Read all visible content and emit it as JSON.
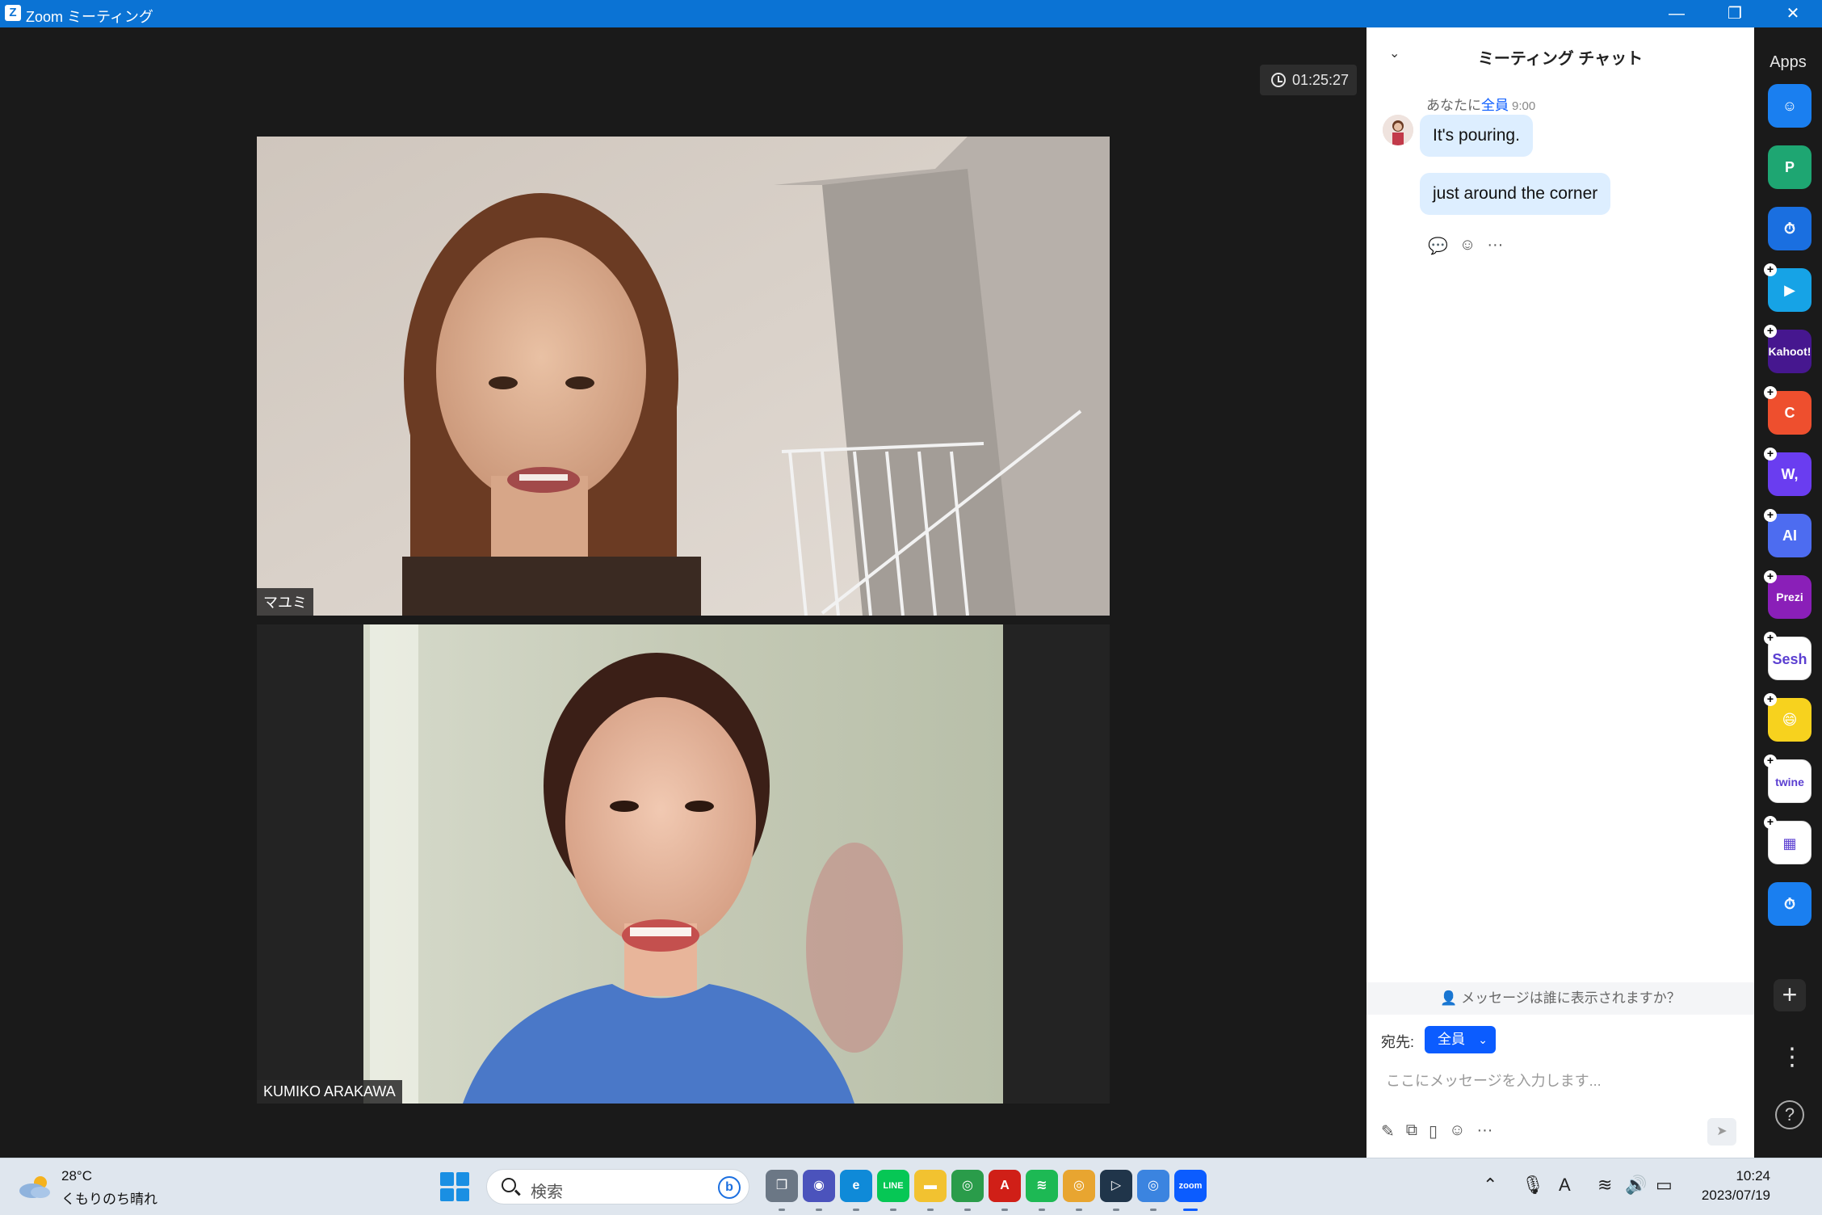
{
  "window": {
    "title": "Zoom ミーティング",
    "logo": "Z",
    "controls": [
      "minimize-icon",
      "restore-icon",
      "close-icon"
    ]
  },
  "meeting": {
    "timer": "01:25:27",
    "participants": [
      {
        "name": "マユミ"
      },
      {
        "name": "KUMIKO ARAKAWA"
      }
    ]
  },
  "chat": {
    "title": "ミーティング チャット",
    "message_group": {
      "sender": "あなたに",
      "to": "全員",
      "time": "9:00",
      "messages": [
        "It's pouring.",
        "just around the corner"
      ]
    },
    "visibility_prompt": "メッセージは誰に表示されますか？",
    "recipient_label": "宛先:",
    "recipient_value": "全員",
    "input_placeholder": "ここにメッセージを入力します..."
  },
  "apps_rail": {
    "label": "Apps",
    "apps": [
      {
        "name": "smile-app",
        "color": "#1a7ff0",
        "text": "☺",
        "plus": false
      },
      {
        "name": "p-app",
        "color": "#1ea672",
        "text": "P",
        "plus": false
      },
      {
        "name": "timer-app",
        "color": "#1a6fe0",
        "text": "⏱",
        "plus": false
      },
      {
        "name": "flip-app",
        "color": "#16a3e6",
        "text": "▶",
        "plus": true
      },
      {
        "name": "kahoot-app",
        "color": "#46178f",
        "text": "Kahoot!",
        "plus": true
      },
      {
        "name": "c-app",
        "color": "#ee4f2e",
        "text": "C",
        "plus": true
      },
      {
        "name": "wooclap-app",
        "color": "#6a3df0",
        "text": "W,",
        "plus": true
      },
      {
        "name": "ai-app",
        "color": "#4d6cf0",
        "text": "AI",
        "plus": true
      },
      {
        "name": "prezi-app",
        "color": "#8a1fb8",
        "text": "Prezi",
        "plus": true
      },
      {
        "name": "sesh-app",
        "color": "#ffffff",
        "text": "Sesh",
        "plus": true
      },
      {
        "name": "emoji-app",
        "color": "#f7d21e",
        "text": "😄",
        "plus": true
      },
      {
        "name": "twine-app",
        "color": "#ffffff",
        "text": "twine",
        "plus": true
      },
      {
        "name": "blocks-app",
        "color": "#ffffff",
        "text": "▦",
        "plus": true
      },
      {
        "name": "stopwatch-app",
        "color": "#1a7ff0",
        "text": "⏱",
        "plus": false
      }
    ]
  },
  "taskbar": {
    "weather_temp": "28°C",
    "weather_desc": "くもりのち晴れ",
    "search_placeholder": "検索",
    "apps": [
      {
        "name": "task-view",
        "color": "#6b7785",
        "text": "❐"
      },
      {
        "name": "teams",
        "color": "#4b53bc",
        "text": "◉"
      },
      {
        "name": "edge",
        "color": "#0f8ad8",
        "text": "e"
      },
      {
        "name": "line",
        "color": "#06c755",
        "text": "LINE"
      },
      {
        "name": "file-explorer",
        "color": "#f2c230",
        "text": "▬"
      },
      {
        "name": "chrome",
        "color": "#2a9c4a",
        "text": "◎"
      },
      {
        "name": "acrobat",
        "color": "#d01f17",
        "text": "A"
      },
      {
        "name": "spotify",
        "color": "#1db954",
        "text": "≋"
      },
      {
        "name": "chrome-profile-1",
        "color": "#e8a530",
        "text": "◎"
      },
      {
        "name": "dev-tool",
        "color": "#20354a",
        "text": "▷"
      },
      {
        "name": "chrome-profile-2",
        "color": "#3b84e0",
        "text": "◎"
      },
      {
        "name": "zoom",
        "color": "#0b5cff",
        "text": "zoom"
      }
    ],
    "time": "10:24",
    "date": "2023/07/19"
  }
}
